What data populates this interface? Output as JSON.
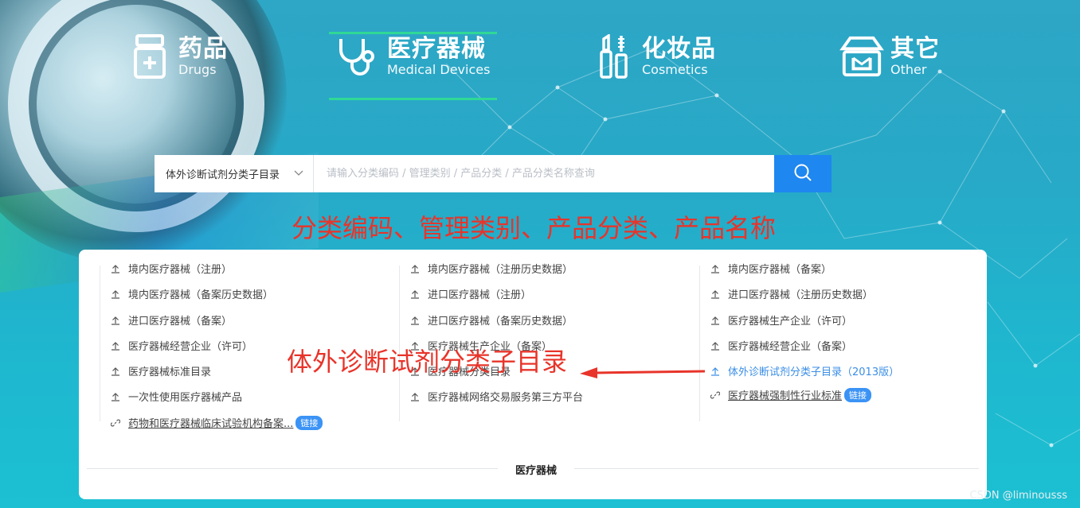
{
  "categories": [
    {
      "zh": "药品",
      "en": "Drugs",
      "icon": "drug-bottle-icon"
    },
    {
      "zh": "医疗器械",
      "en": "Medical Devices",
      "icon": "stethoscope-icon"
    },
    {
      "zh": "化妆品",
      "en": "Cosmetics",
      "icon": "lipstick-icon"
    },
    {
      "zh": "其它",
      "en": "Other",
      "icon": "store-icon"
    }
  ],
  "search": {
    "selected": "体外诊断试剂分类子目录",
    "placeholder": "请输入分类编码 / 管理类别 / 产品分类 / 产品分类名称查询"
  },
  "annotations": {
    "top": "分类编码、管理类别、产品分类、产品名称",
    "middle": "体外诊断试剂分类子目录"
  },
  "panel": {
    "items": [
      {
        "label": "境内医疗器械（注册）",
        "type": "upload"
      },
      {
        "label": "境内医疗器械（注册历史数据）",
        "type": "upload"
      },
      {
        "label": "境内医疗器械（备案）",
        "type": "upload"
      },
      {
        "label": "境内医疗器械（备案历史数据）",
        "type": "upload"
      },
      {
        "label": "进口医疗器械（注册）",
        "type": "upload"
      },
      {
        "label": "进口医疗器械（注册历史数据）",
        "type": "upload"
      },
      {
        "label": "进口医疗器械（备案）",
        "type": "upload"
      },
      {
        "label": "进口医疗器械（备案历史数据）",
        "type": "upload"
      },
      {
        "label": "医疗器械生产企业（许可）",
        "type": "upload"
      },
      {
        "label": "医疗器械经营企业（许可）",
        "type": "upload"
      },
      {
        "label": "医疗器械生产企业（备案）",
        "type": "upload"
      },
      {
        "label": "医疗器械经营企业（备案）",
        "type": "upload"
      },
      {
        "label": "医疗器械标准目录",
        "type": "upload"
      },
      {
        "label": "医疗器械分类目录",
        "type": "upload"
      },
      {
        "label": "体外诊断试剂分类子目录（2013版）",
        "type": "upload"
      },
      {
        "label": "一次性使用医疗器械产品",
        "type": "upload"
      },
      {
        "label": "医疗器械网络交易服务第三方平台",
        "type": "upload"
      },
      {
        "label": "医疗器械强制性行业标准",
        "type": "link"
      },
      {
        "label": "药物和医疗器械临床试验机构备案...",
        "type": "link"
      }
    ],
    "link_badge": "链接",
    "footer_title": "医疗器械"
  },
  "watermark": "CSDN @liminousss",
  "colors": {
    "accent": "#1e87f0",
    "tab_underline": "#2fd996",
    "annotation_red": "#e8342a",
    "highlight_blue": "#3a8ee6"
  }
}
